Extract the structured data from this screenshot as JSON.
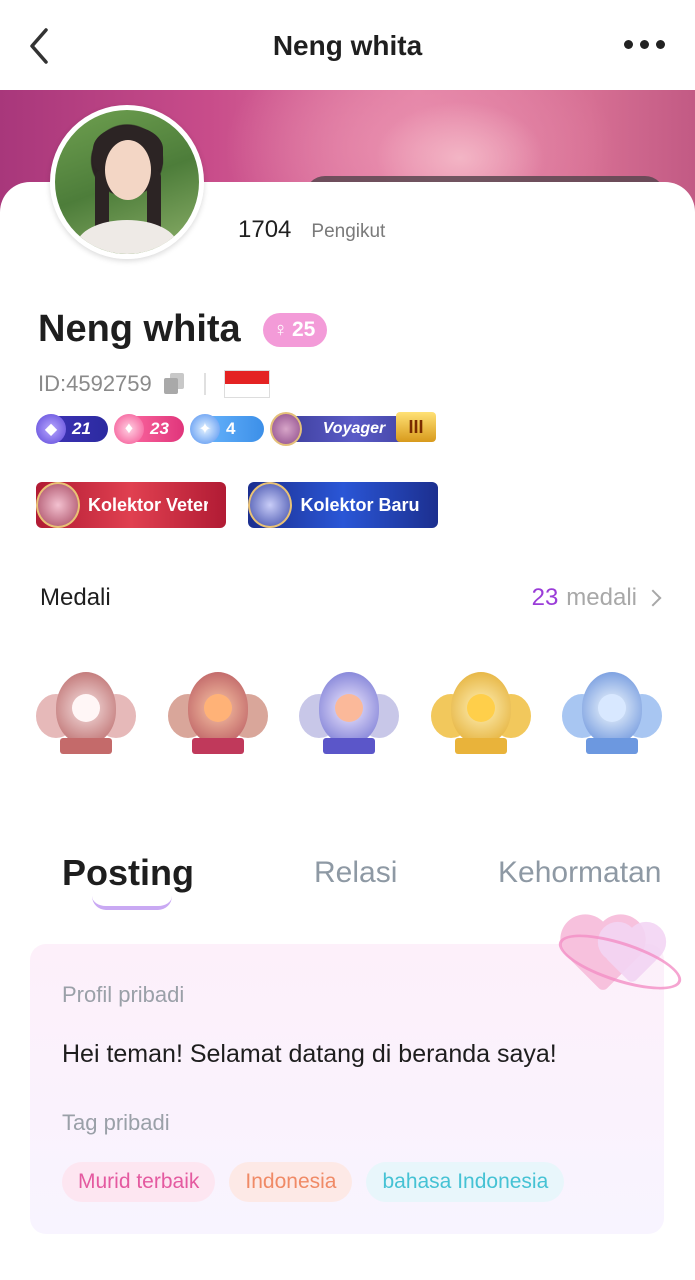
{
  "header": {
    "title": "Neng whita"
  },
  "profile": {
    "followers_count": "1704",
    "followers_label": "Pengikut",
    "name": "Neng whita",
    "level": "25",
    "user_id": "ID:4592759",
    "country_flag": "Indonesia"
  },
  "badges": {
    "pill1": "21",
    "pill2": "23",
    "pill3": "4",
    "voyager": "Voyager",
    "voyager_rank": "III"
  },
  "titles": [
    {
      "label": "Kolektor Veteran"
    },
    {
      "label": "Kolektor Baru"
    }
  ],
  "medals_section": {
    "heading": "Medali",
    "count": "23",
    "count_suffix": "medali"
  },
  "tabs": [
    {
      "label": "Posting"
    },
    {
      "label": "Relasi"
    },
    {
      "label": "Kehormatan"
    }
  ],
  "about": {
    "profile_label": "Profil pribadi",
    "profile_text": "Hei teman! Selamat datang di beranda saya!",
    "tags_label": "Tag pribadi",
    "tags": [
      "Murid terbaik",
      "Indonesia",
      "bahasa Indonesia"
    ]
  },
  "colors": {
    "accent_purple": "#9a3cd8",
    "level_pink": "#f39bd8",
    "tag_pink": "#e45aa0",
    "tag_orange": "#f08a66",
    "tag_cyan": "#45c2d4"
  }
}
